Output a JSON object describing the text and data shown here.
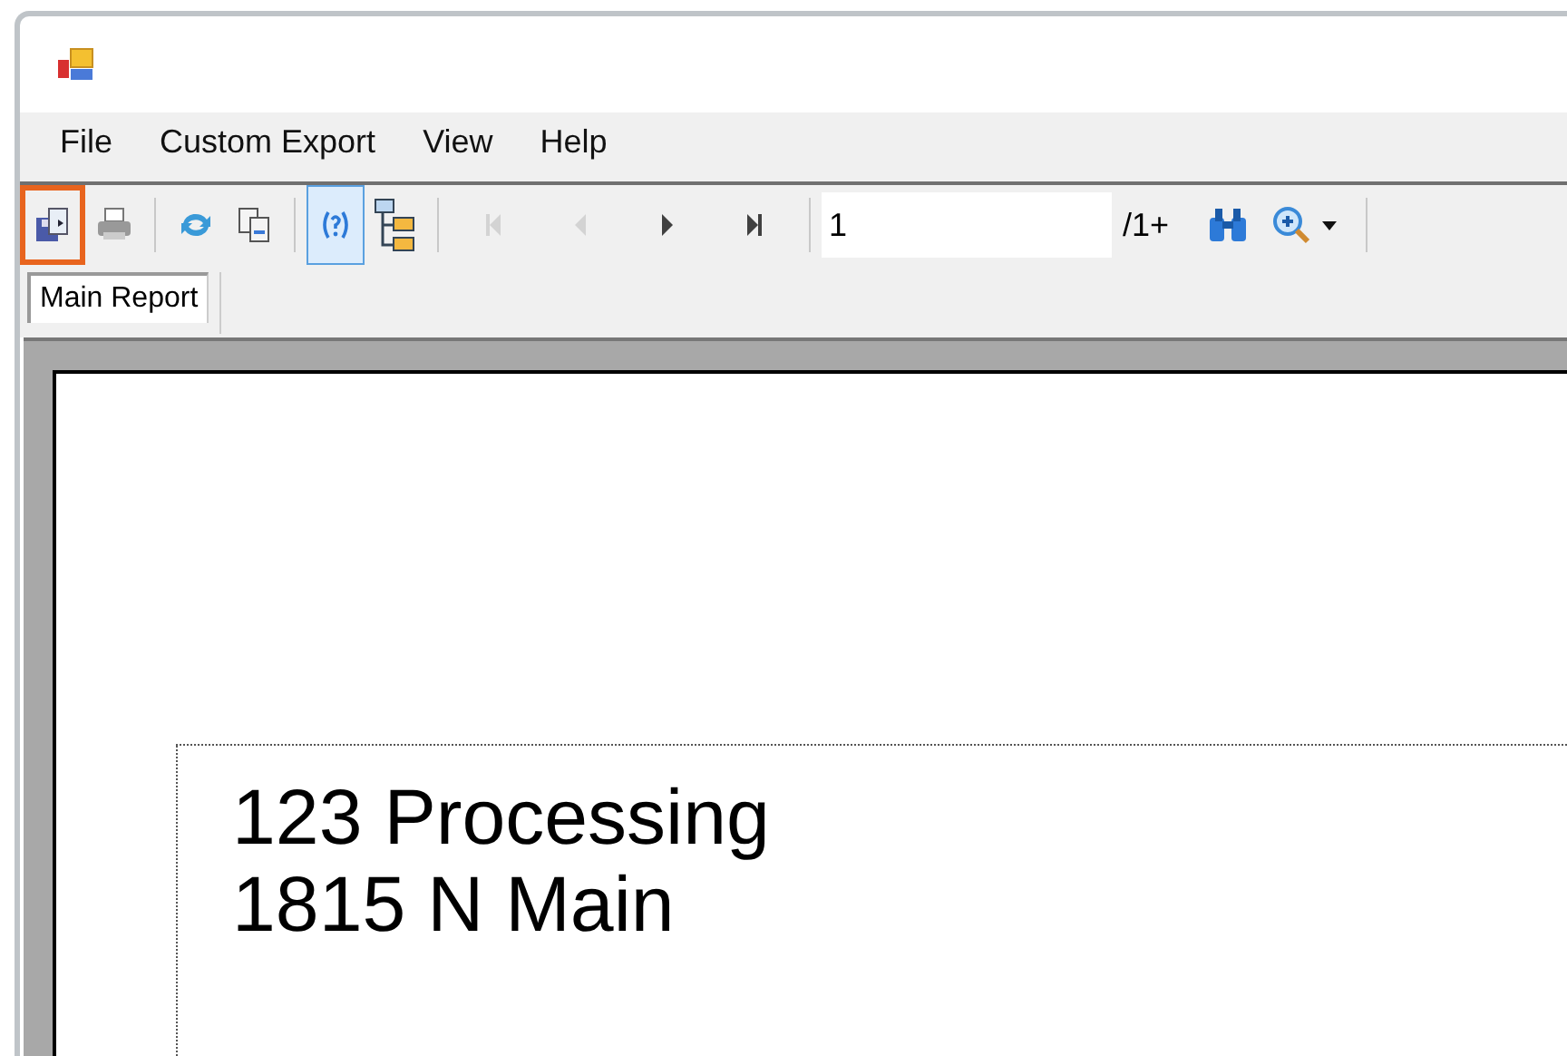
{
  "menu": [
    {
      "label": "File"
    },
    {
      "label": "Custom Export"
    },
    {
      "label": "View"
    },
    {
      "label": "Help"
    }
  ],
  "toolbar": {
    "buttons_left": [
      {
        "kind": "export",
        "highlighted": true,
        "on": false,
        "disabled": false
      },
      {
        "kind": "print",
        "highlighted": false,
        "on": false,
        "disabled": false
      },
      {
        "kind": "sep"
      },
      {
        "kind": "refresh",
        "highlighted": false,
        "on": false,
        "disabled": false
      },
      {
        "kind": "copy",
        "highlighted": false,
        "on": false,
        "disabled": false
      },
      {
        "kind": "sep"
      },
      {
        "kind": "help",
        "highlighted": false,
        "on": true,
        "disabled": false
      },
      {
        "kind": "tree",
        "highlighted": false,
        "on": false,
        "disabled": false
      },
      {
        "kind": "sep"
      },
      {
        "kind": "first",
        "highlighted": false,
        "on": false,
        "disabled": true
      },
      {
        "kind": "prev",
        "highlighted": false,
        "on": false,
        "disabled": true
      },
      {
        "kind": "next",
        "highlighted": false,
        "on": false,
        "disabled": false
      },
      {
        "kind": "last",
        "highlighted": false,
        "on": false,
        "disabled": false
      },
      {
        "kind": "sep"
      }
    ],
    "page_value": "1",
    "page_count": "/1+",
    "buttons_right": [
      {
        "kind": "find"
      },
      {
        "kind": "zoom"
      },
      {
        "kind": "sep"
      }
    ]
  },
  "tabs": [
    {
      "label": "Main Report",
      "selected": true
    }
  ],
  "report": {
    "lines": [
      "123 Processing",
      "1815 N Main"
    ]
  }
}
